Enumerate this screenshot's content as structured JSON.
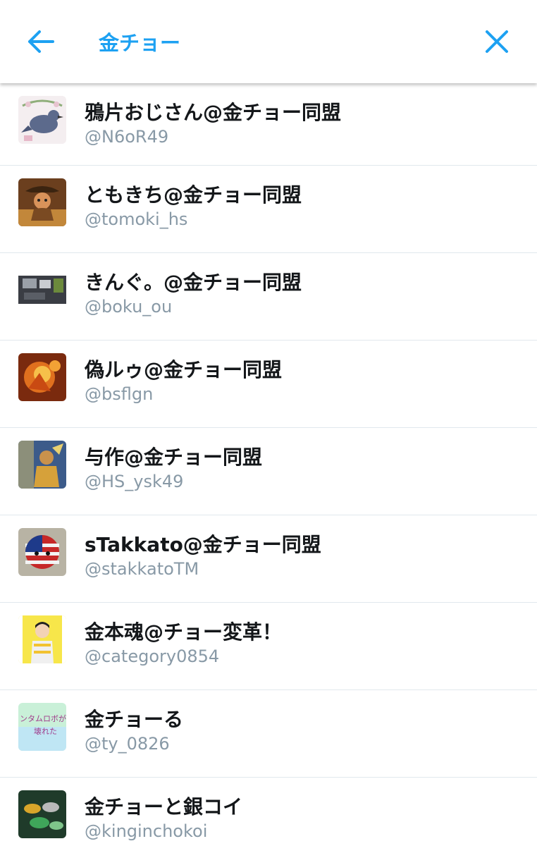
{
  "header": {
    "query": "金チョー",
    "back_icon": "arrow-left-icon",
    "close_icon": "close-icon",
    "accent": "#1da1f2"
  },
  "results": [
    {
      "name": "鴉片おじさん@金チョー同盟",
      "handle": "@N6oR49",
      "avatar": "bird-avatar"
    },
    {
      "name": "ともきち@金チョー同盟",
      "handle": "@tomoki_hs",
      "avatar": "cowboy-avatar"
    },
    {
      "name": "きんぐ。@金チョー同盟",
      "handle": "@boku_ou",
      "avatar": "screenshot-avatar"
    },
    {
      "name": "偽ルゥ@金チョー同盟",
      "handle": "@bsflgn",
      "avatar": "fire-creature-avatar"
    },
    {
      "name": "与作@金チョー同盟",
      "handle": "@HS_ysk49",
      "avatar": "warrior-avatar"
    },
    {
      "name": "sTakkato@金チョー同盟",
      "handle": "@stakkatoTM",
      "avatar": "flag-ball-avatar"
    },
    {
      "name": "金本魂@チョー変革！",
      "handle": "@category0854",
      "avatar": "idol-avatar"
    },
    {
      "name": "金チョーる",
      "handle": "@ty_0826",
      "avatar": "robot-text-avatar",
      "avatar_text": "ンタムロボが 壊れた"
    },
    {
      "name": "金チョーと銀コイ",
      "handle": "@kinginchokoi",
      "avatar": "fish-avatar"
    }
  ],
  "colors": {
    "name_text": "#14171a",
    "handle_text": "#8899a6",
    "divider": "#e1e8ed"
  }
}
